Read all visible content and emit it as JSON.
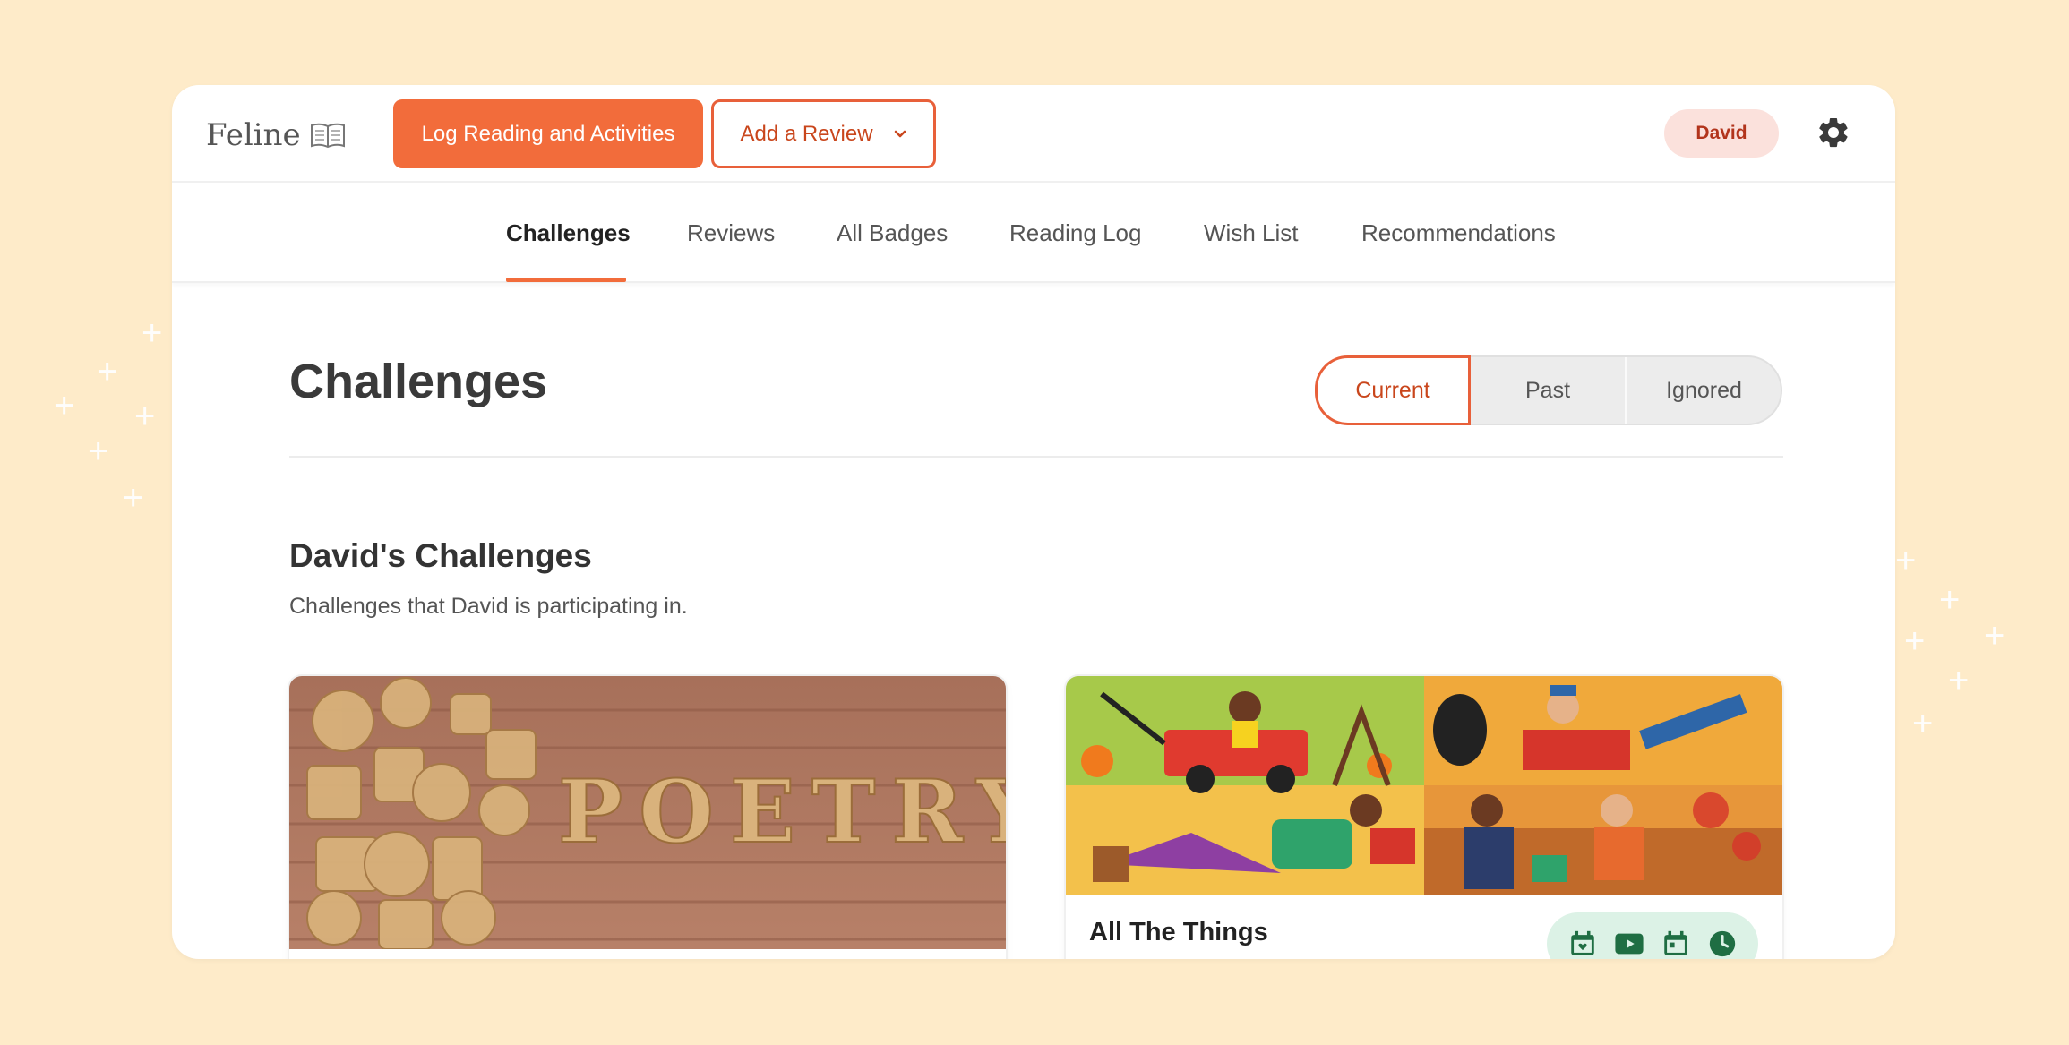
{
  "app": {
    "logo_text": "Feline",
    "primary_action": "Log Reading and Activities",
    "review_action": "Add a Review",
    "user_name": "David"
  },
  "nav": {
    "tabs": [
      {
        "label": "Challenges",
        "active": true
      },
      {
        "label": "Reviews"
      },
      {
        "label": "All Badges"
      },
      {
        "label": "Reading Log"
      },
      {
        "label": "Wish List"
      },
      {
        "label": "Recommendations"
      }
    ]
  },
  "page": {
    "title": "Challenges",
    "filters": [
      {
        "label": "Current",
        "active": true
      },
      {
        "label": "Past"
      },
      {
        "label": "Ignored"
      }
    ]
  },
  "section": {
    "title": "David's Challenges",
    "subtitle": "Challenges that David is participating in."
  },
  "cards": [
    {
      "image_text": "POETRY"
    },
    {
      "title": "All The Things",
      "badge_icons": [
        "calendar-heart-icon",
        "video-icon",
        "calendar-icon",
        "clock-icon"
      ]
    }
  ],
  "colors": {
    "accent": "#f26c3b",
    "background": "#feebc9",
    "badge_bg": "#dcf2e6",
    "badge_icon": "#1f6e43"
  }
}
